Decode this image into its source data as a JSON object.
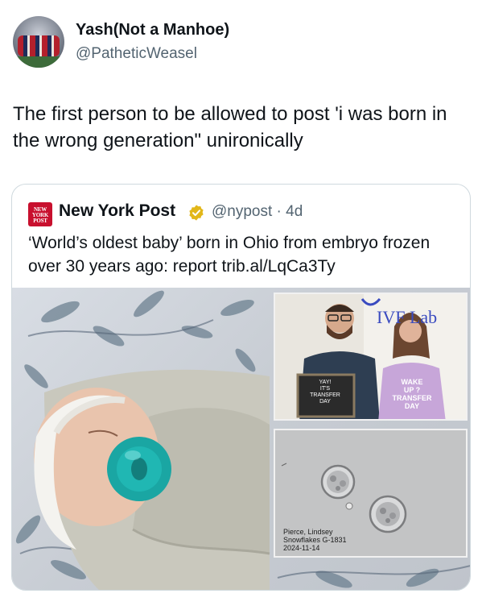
{
  "tweet": {
    "author_name": "Yash(Not a Manhoe)",
    "author_handle": "@PatheticWeasel",
    "text": "The first person to be allowed to post 'i was born in the wrong generation\" unironically"
  },
  "quoted": {
    "logo_text": "NEW YORK POST",
    "author_name": "New York Post",
    "author_handle": "@nypost · 4d",
    "text": "‘World’s oldest baby’ born in Ohio from embryo frozen over 30 years ago: report trib.al/LqCa3Ty",
    "verified_icon": "verified-gold-badge-icon",
    "colors": {
      "nypost_red": "#c8102e",
      "verified_gold": "#e2b719",
      "pacifier_teal": "#1aa6a3"
    }
  },
  "media": {
    "sign_lines": [
      "YAY!",
      "IT'S",
      "TRANSFER",
      "DAY"
    ],
    "shirt_text": [
      "WAKE",
      "UP ?",
      "TRANSFER",
      "DAY"
    ],
    "lab_text": "IVF Lab",
    "microscope_label": [
      "Pierce, Lindsey",
      "Snowflakes G-1831",
      "2024-11-14"
    ]
  }
}
